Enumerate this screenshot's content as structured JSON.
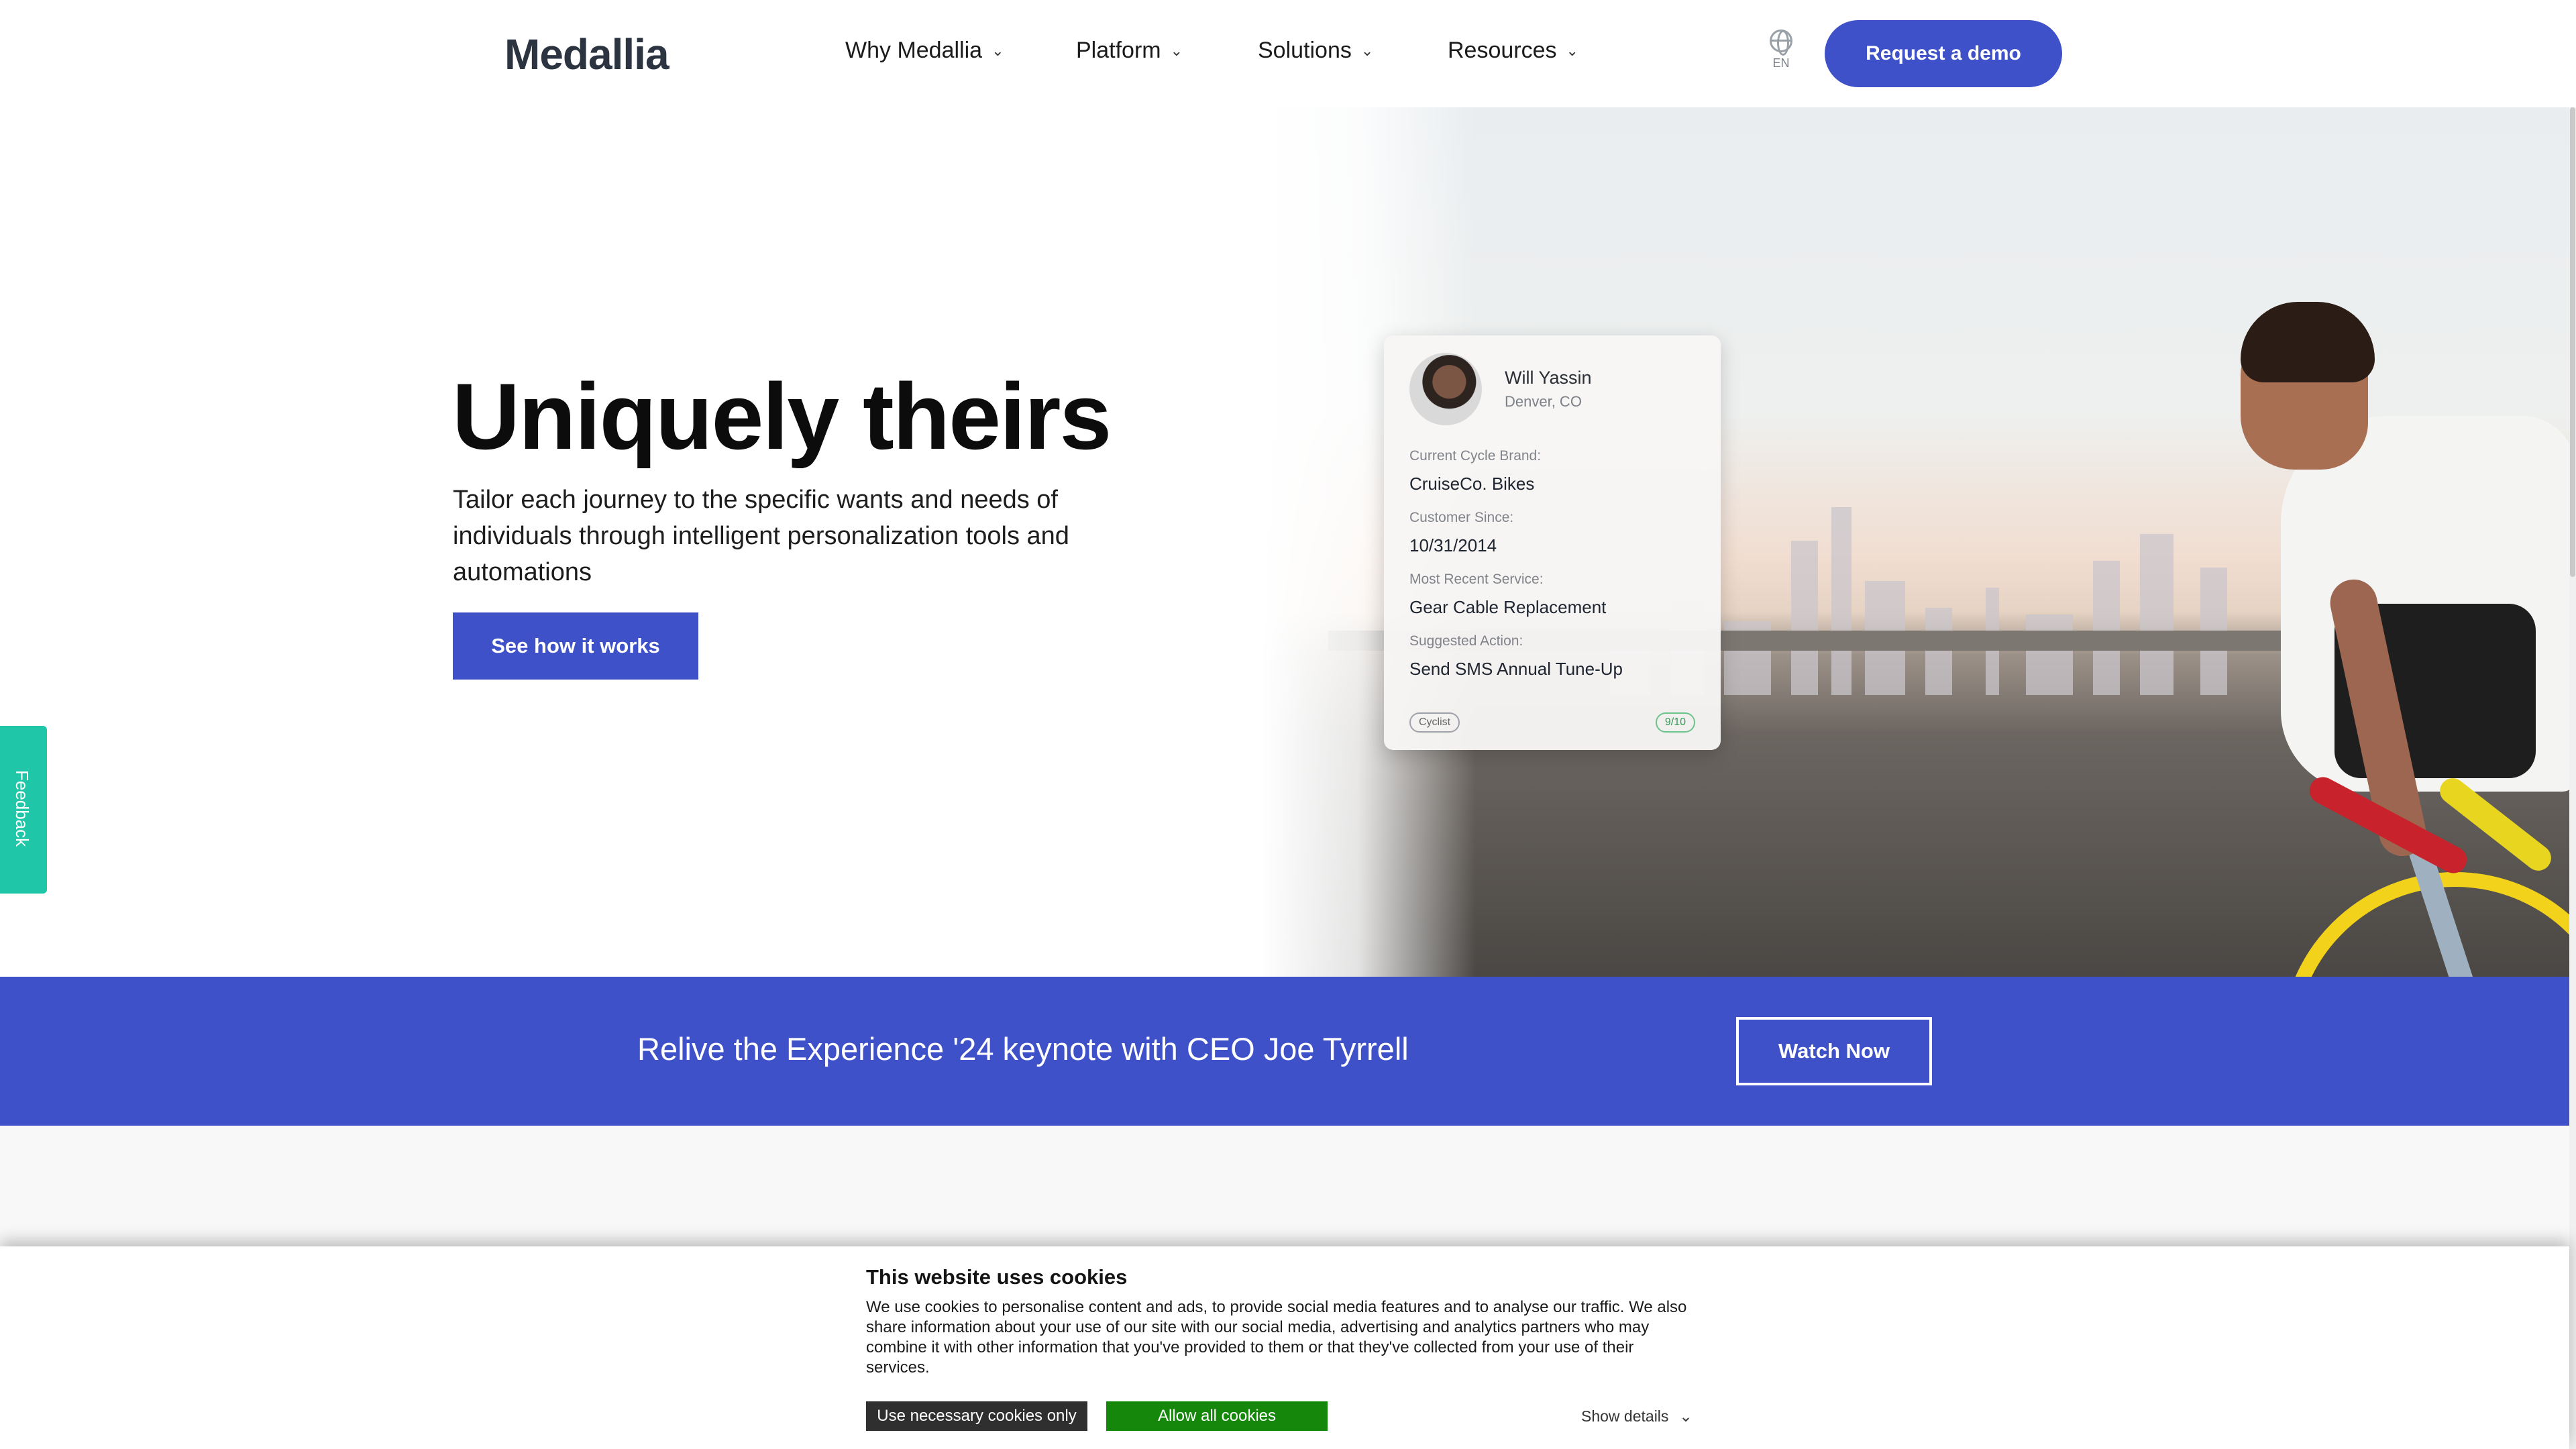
{
  "header": {
    "logo": "Medallia",
    "nav": [
      {
        "label": "Why Medallia"
      },
      {
        "label": "Platform"
      },
      {
        "label": "Solutions"
      },
      {
        "label": "Resources"
      }
    ],
    "language": "EN",
    "demo_button": "Request a demo"
  },
  "hero": {
    "title": "Uniquely theirs",
    "subtitle": "Tailor each journey to the specific wants and needs of individuals through intelligent personalization tools and automations",
    "cta": "See how it works"
  },
  "profile_card": {
    "name": "Will Yassin",
    "location": "Denver, CO",
    "fields": [
      {
        "label": "Current Cycle Brand:",
        "value": "CruiseCo. Bikes"
      },
      {
        "label": "Customer Since:",
        "value": "10/31/2014"
      },
      {
        "label": "Most Recent Service:",
        "value": "Gear Cable Replacement"
      },
      {
        "label": "Suggested Action:",
        "value": "Send SMS Annual Tune-Up"
      }
    ],
    "tag": "Cyclist",
    "score": "9/10"
  },
  "feedback_tab": "Feedback",
  "banner": {
    "text": "Relive the Experience '24 keynote with CEO Joe Tyrrell",
    "button": "Watch Now"
  },
  "cookie": {
    "title": "This website uses cookies",
    "body": "We use cookies to personalise content and ads, to provide social media features and to analyse our traffic. We also share information about your use of our site with our social media, advertising and analytics partners who may combine it with other information that you've provided to them or that they've collected from your use of their services.",
    "necessary_button": "Use necessary cookies only",
    "allow_button": "Allow all cookies",
    "details_link": "Show details"
  },
  "colors": {
    "brand": "#3f51c8",
    "feedback": "#1fc7a8",
    "allow_button": "#15870a"
  }
}
